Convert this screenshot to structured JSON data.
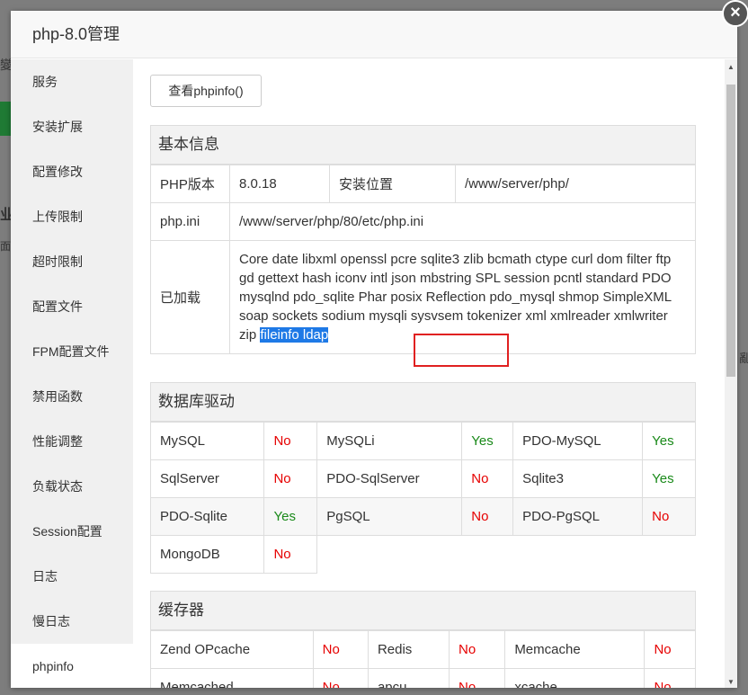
{
  "dialog": {
    "title": "php-8.0管理",
    "close_glyph": "×"
  },
  "background": {
    "glyph_1": "變",
    "glyph_2": "业",
    "glyph_3": "面",
    "glyph_4": "亂"
  },
  "sidebar": {
    "items": [
      {
        "label": "服务"
      },
      {
        "label": "安装扩展"
      },
      {
        "label": "配置修改"
      },
      {
        "label": "上传限制"
      },
      {
        "label": "超时限制"
      },
      {
        "label": "配置文件"
      },
      {
        "label": "FPM配置文件"
      },
      {
        "label": "禁用函数"
      },
      {
        "label": "性能调整"
      },
      {
        "label": "负载状态"
      },
      {
        "label": "Session配置"
      },
      {
        "label": "日志"
      },
      {
        "label": "慢日志"
      },
      {
        "label": "phpinfo"
      }
    ],
    "active_index": 13
  },
  "content": {
    "phpinfo_button": "查看phpinfo()",
    "basic": {
      "title": "基本信息",
      "php_version_label": "PHP版本",
      "php_version": "8.0.18",
      "install_path_label": "安装位置",
      "install_path": "/www/server/php/",
      "phpini_label": "php.ini",
      "phpini_path": "/www/server/php/80/etc/php.ini",
      "loaded_label": "已加载",
      "loaded_extensions": "Core date libxml openssl pcre sqlite3 zlib bcmath ctype curl dom filter ftp gd gettext hash iconv intl json mbstring SPL session pcntl standard PDO mysqlnd pdo_sqlite Phar posix Reflection pdo_mysql shmop SimpleXML soap sockets sodium mysqli sysvsem tokenizer xml xmlreader xmlwriter zip",
      "loaded_extensions_highlighted": "fileinfo ldap"
    },
    "db": {
      "title": "数据库驱动",
      "rows": [
        [
          {
            "name": "MySQL",
            "status": "No"
          },
          {
            "name": "MySQLi",
            "status": "Yes"
          },
          {
            "name": "PDO-MySQL",
            "status": "Yes"
          }
        ],
        [
          {
            "name": "SqlServer",
            "status": "No"
          },
          {
            "name": "PDO-SqlServer",
            "status": "No"
          },
          {
            "name": "Sqlite3",
            "status": "Yes"
          }
        ],
        [
          {
            "name": "PDO-Sqlite",
            "status": "Yes"
          },
          {
            "name": "PgSQL",
            "status": "No"
          },
          {
            "name": "PDO-PgSQL",
            "status": "No"
          }
        ],
        [
          {
            "name": "MongoDB",
            "status": "No"
          }
        ]
      ]
    },
    "cache": {
      "title": "缓存器",
      "rows": [
        [
          {
            "name": "Zend OPcache",
            "status": "No"
          },
          {
            "name": "Redis",
            "status": "No"
          },
          {
            "name": "Memcache",
            "status": "No"
          }
        ],
        [
          {
            "name": "Memcached",
            "status": "No"
          },
          {
            "name": "apcu",
            "status": "No"
          },
          {
            "name": "xcache",
            "status": "No"
          }
        ]
      ]
    }
  },
  "colors": {
    "yes": "#1a8a1a",
    "no": "#e60000",
    "selection": "#1e79e6",
    "annotation_box": "#e02020"
  }
}
